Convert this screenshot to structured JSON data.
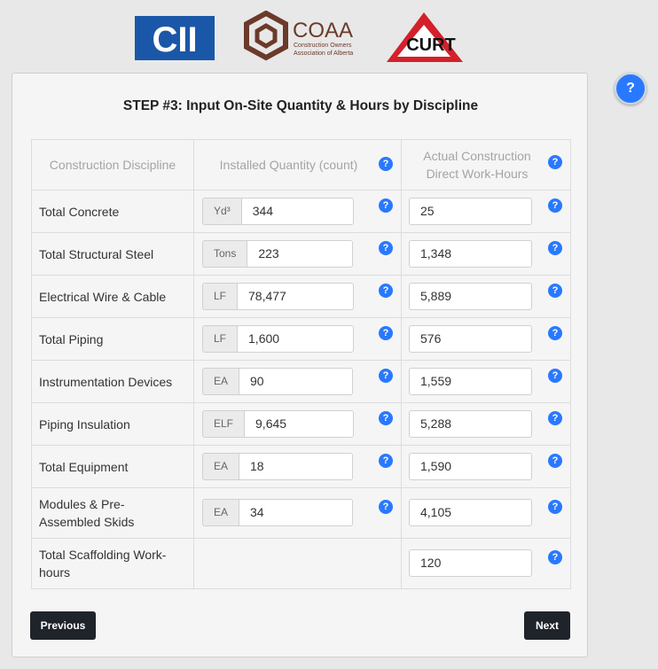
{
  "logos": {
    "cii": "CII",
    "coaa_title": "COAA",
    "coaa_sub1": "Construction Owners",
    "coaa_sub2": "Association of Alberta",
    "curt": "CURT"
  },
  "help_label": "?",
  "title": "STEP #3: Input On-Site Quantity & Hours by Discipline",
  "headers": {
    "discipline": "Construction Discipline",
    "quantity": "Installed Quantity (count)",
    "hours_line1": "Actual Construction",
    "hours_line2": "Direct Work-Hours"
  },
  "rows": [
    {
      "discipline": "Total Concrete",
      "unit": "Yd³",
      "quantity": "344",
      "hours": "25"
    },
    {
      "discipline": "Total Structural Steel",
      "unit": "Tons",
      "quantity": "223",
      "hours": "1,348"
    },
    {
      "discipline": "Electrical Wire & Cable",
      "unit": "LF",
      "quantity": "78,477",
      "hours": "5,889"
    },
    {
      "discipline": "Total Piping",
      "unit": "LF",
      "quantity": "1,600",
      "hours": "576"
    },
    {
      "discipline": "Instrumentation Devices",
      "unit": "EA",
      "quantity": "90",
      "hours": "1,559"
    },
    {
      "discipline": "Piping Insulation",
      "unit": "ELF",
      "quantity": "9,645",
      "hours": "5,288"
    },
    {
      "discipline": "Total Equipment",
      "unit": "EA",
      "quantity": "18",
      "hours": "1,590"
    },
    {
      "discipline_line1": "Modules & Pre-",
      "discipline_line2": "Assembled Skids",
      "unit": "EA",
      "quantity": "34",
      "hours": "4,105"
    },
    {
      "discipline_line1": "Total Scaffolding Work-",
      "discipline_line2": "hours",
      "hours": "120"
    }
  ],
  "buttons": {
    "previous": "Previous",
    "next": "Next"
  },
  "colors": {
    "accent": "#2979ff",
    "button": "#1f242a",
    "cii_blue": "#1b57a8",
    "coaa_brown": "#6b3a2a",
    "curt_red": "#d4202a"
  }
}
